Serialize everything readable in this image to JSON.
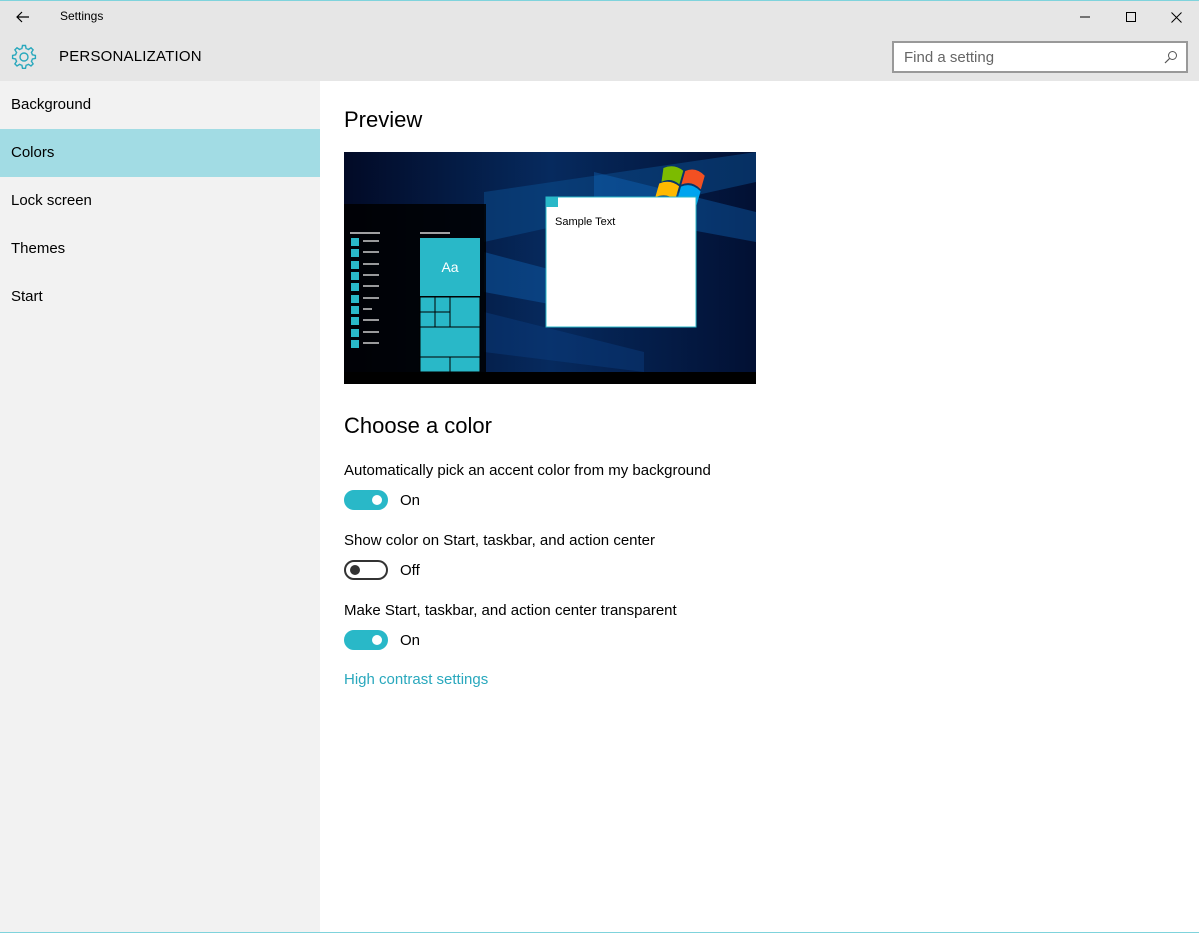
{
  "window": {
    "title": "Settings"
  },
  "header": {
    "section_title": "PERSONALIZATION",
    "search": {
      "placeholder": "Find a setting",
      "value": ""
    }
  },
  "sidebar": {
    "items": [
      {
        "label": "Background",
        "active": false
      },
      {
        "label": "Colors",
        "active": true
      },
      {
        "label": "Lock screen",
        "active": false
      },
      {
        "label": "Themes",
        "active": false
      },
      {
        "label": "Start",
        "active": false
      }
    ]
  },
  "main": {
    "preview_heading": "Preview",
    "preview": {
      "tile_text": "Aa",
      "sample_text": "Sample Text"
    },
    "choose_heading": "Choose a color",
    "options": [
      {
        "label": "Automatically pick an accent color from my background",
        "state": "On"
      },
      {
        "label": "Show color on Start, taskbar, and action center",
        "state": "Off"
      },
      {
        "label": "Make Start, taskbar, and action center transparent",
        "state": "On"
      }
    ],
    "link": "High contrast settings"
  },
  "colors": {
    "accent": "#29b8c8",
    "sidebar_active": "#a2dce4",
    "link": "#29a8bd",
    "titlebar": "#e6e6e6",
    "sidebar_bg": "#f2f2f2"
  },
  "icons": {
    "back": "back-arrow-icon",
    "minimize": "minimize-icon",
    "maximize": "maximize-icon",
    "close": "close-icon",
    "header": "gear-icon",
    "search": "search-icon"
  }
}
